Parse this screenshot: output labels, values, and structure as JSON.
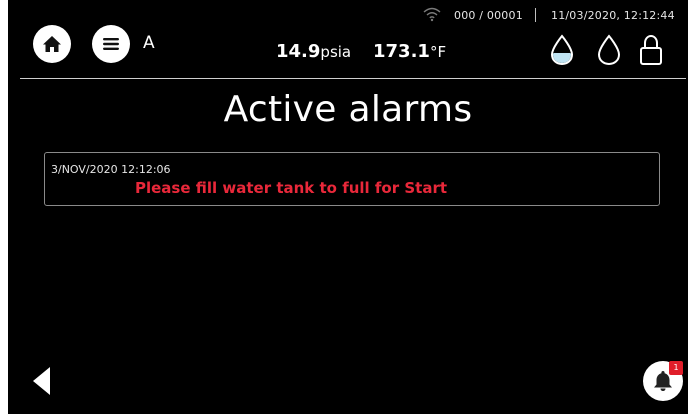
{
  "status_bar": {
    "counter": "000 / 00001",
    "datetime": "11/03/2020, 12:12:44"
  },
  "header": {
    "user_letter": "A",
    "pressure": {
      "value": "14.9",
      "unit": "psia"
    },
    "temperature": {
      "value": "173.1",
      "unit": "°F"
    }
  },
  "page": {
    "title": "Active alarms"
  },
  "alarms": [
    {
      "timestamp": "3/NOV/2020 12:12:06",
      "message": "Please fill water tank to full for Start"
    }
  ],
  "notifications": {
    "badge_count": "1"
  },
  "colors": {
    "background": "#000000",
    "text": "#ffffff",
    "alarm_text": "#e9283a",
    "badge": "#e01e2a",
    "water_fill": "#bfe3f2"
  },
  "icons": {
    "home": "home-icon",
    "menu": "menu-icon",
    "wifi": "wifi-icon",
    "water_full": "water-drop-full-icon",
    "water_empty": "water-drop-empty-icon",
    "lock": "lock-icon",
    "back": "back-arrow-icon",
    "bell": "bell-icon"
  }
}
